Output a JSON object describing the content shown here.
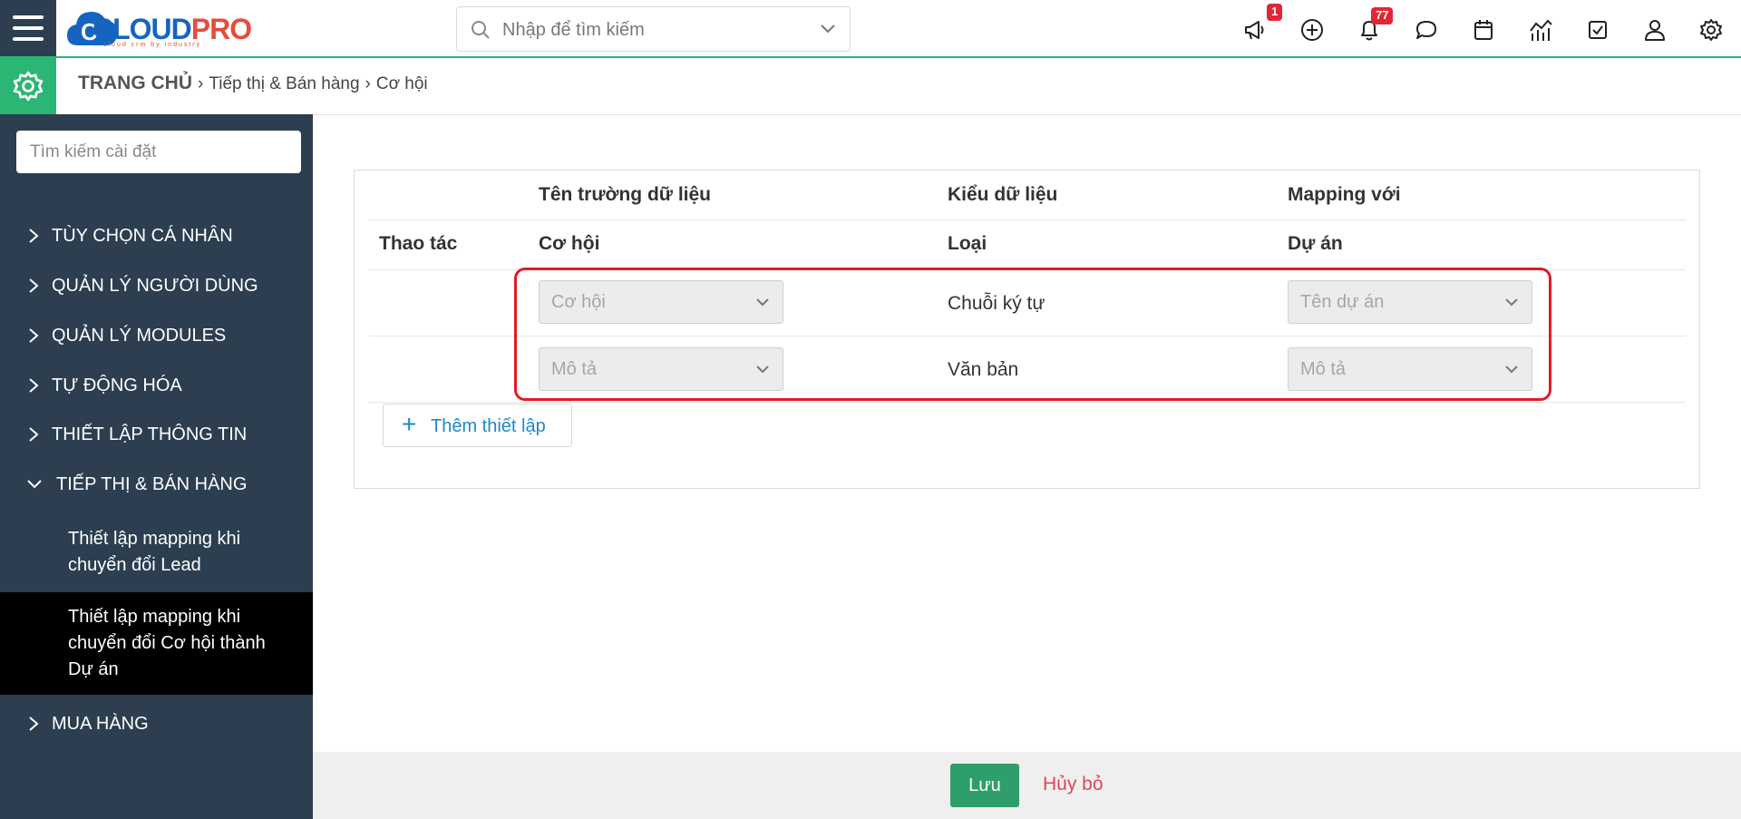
{
  "app": {
    "logo_text_1": "CLOUD",
    "logo_text_2": "PRO",
    "logo_sub": "cloud crm by industry",
    "brand_color": "#2bb673",
    "sidebar_color": "#2c3e50"
  },
  "header": {
    "search_placeholder": "Nhập để tìm kiếm",
    "announcement_badge": "1",
    "notification_badge": "77",
    "icons": [
      "megaphone-icon",
      "plus-circle-icon",
      "bell-icon",
      "chat-icon",
      "calendar-icon",
      "chart-icon",
      "checkbox-icon",
      "user-icon",
      "gear-icon"
    ]
  },
  "breadcrumb": {
    "home": "TRANG CHỦ",
    "level1": "Tiếp thị & Bán hàng",
    "level2": "Cơ hội"
  },
  "sidebar": {
    "search_placeholder": "Tìm kiếm cài đặt",
    "items": [
      {
        "label": "TÙY CHỌN CÁ NHÂN"
      },
      {
        "label": "QUẢN LÝ NGƯỜI DÙNG"
      },
      {
        "label": "QUẢN LÝ MODULES"
      },
      {
        "label": "TỰ ĐỘNG HÓA"
      },
      {
        "label": "THIẾT LẬP THÔNG TIN"
      },
      {
        "label": "TIẾP THỊ & BÁN HÀNG"
      },
      {
        "label": "MUA HÀNG"
      }
    ],
    "subitems": [
      {
        "label": "Thiết lập mapping khi chuyển đổi Lead"
      },
      {
        "label": "Thiết lập mapping khi chuyển đổi Cơ hội thành Dự án"
      }
    ]
  },
  "table": {
    "header1": {
      "field_name": "Tên trường dữ liệu",
      "data_type": "Kiểu dữ liệu",
      "mapping": "Mapping với"
    },
    "header2": {
      "action": "Thao tác",
      "source": "Cơ hội",
      "type": "Loại",
      "target": "Dự án"
    },
    "rows": [
      {
        "source": "Cơ hội",
        "type": "Chuỗi ký tự",
        "target": "Tên dự án"
      },
      {
        "source": "Mô tả",
        "type": "Văn bản",
        "target": "Mô tả"
      }
    ],
    "add_label": "Thêm thiết lập"
  },
  "footer": {
    "save_label": "Lưu",
    "cancel_label": "Hủy bỏ"
  }
}
